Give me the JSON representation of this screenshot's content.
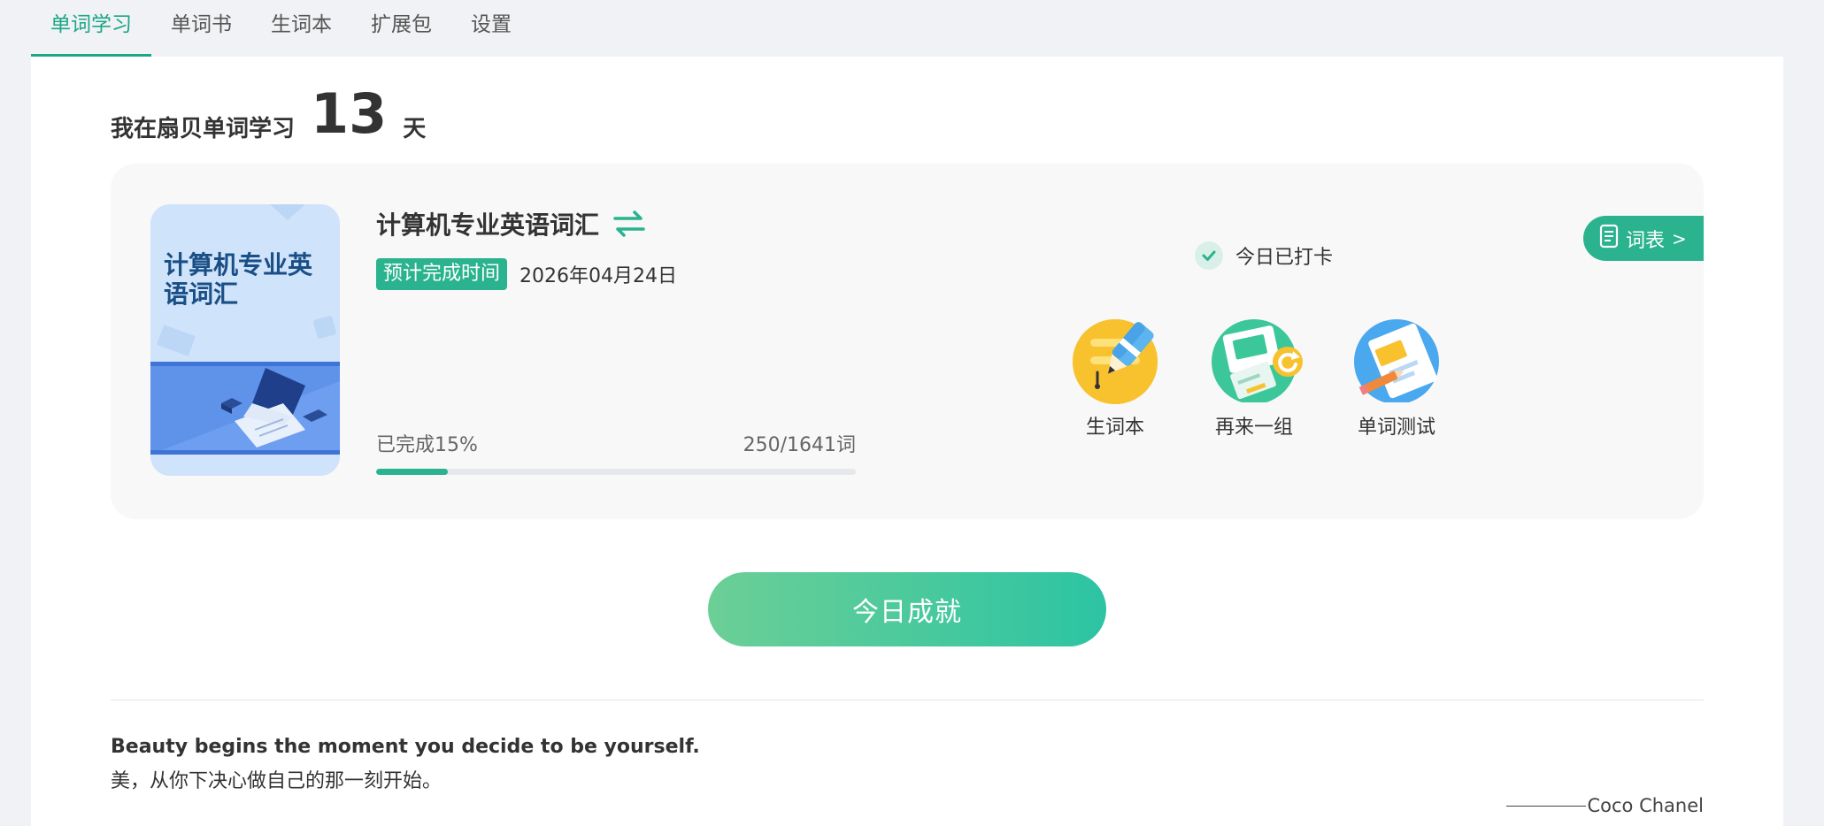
{
  "tabs": [
    {
      "label": "单词学习",
      "active": true
    },
    {
      "label": "单词书",
      "active": false
    },
    {
      "label": "生词本",
      "active": false
    },
    {
      "label": "扩展包",
      "active": false
    },
    {
      "label": "设置",
      "active": false
    }
  ],
  "streak": {
    "prefix": "我在扇贝单词学习",
    "days": "13",
    "suffix": "天"
  },
  "book": {
    "cover_title": "计算机专业英语词汇",
    "title": "计算机专业英语词汇",
    "eta_label": "预计完成时间",
    "eta_date": "2026年04月24日",
    "progress_label": "已完成15%",
    "progress_count": "250/1641词",
    "progress_fraction": 0.15
  },
  "checkin": {
    "label": "今日已打卡"
  },
  "wordlist_button": {
    "label": "词表",
    "chevron": ">"
  },
  "actions": [
    {
      "label": "生词本",
      "icon": "pen-notebook-icon"
    },
    {
      "label": "再来一组",
      "icon": "refresh-card-icon"
    },
    {
      "label": "单词测试",
      "icon": "test-paper-icon"
    }
  ],
  "achievement_button": {
    "label": "今日成就"
  },
  "quote": {
    "en": "Beauty begins the moment you decide to be yourself.",
    "zh": "美，从你下决心做自己的那一刻开始。",
    "author": "Coco Chanel"
  },
  "colors": {
    "accent": "#2ab38e",
    "tab_active": "#1aa787",
    "page_bg": "#f1f2f5",
    "card_bg": "#f8f8f9"
  }
}
